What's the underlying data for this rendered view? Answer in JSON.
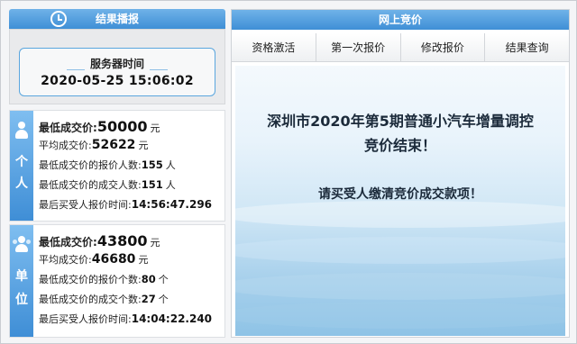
{
  "left": {
    "header_title": "结果播报",
    "server_label": "服务器时间",
    "server_time": "2020-05-25 15:06:02",
    "personal": {
      "tab_chars": [
        "个",
        "人"
      ],
      "rows": [
        {
          "label": "最低成交价:",
          "value": "50000",
          "unit": "元"
        },
        {
          "label": "平均成交价:",
          "value": "52622",
          "unit": "元"
        },
        {
          "label": "最低成交价的报价人数:",
          "value": "155",
          "unit": "人"
        },
        {
          "label": "最低成交价的成交人数:",
          "value": "151",
          "unit": "人"
        },
        {
          "label": "最后买受人报价时间:",
          "value": "14:56:47.296",
          "unit": ""
        }
      ]
    },
    "unit": {
      "tab_chars": [
        "单",
        "位"
      ],
      "rows": [
        {
          "label": "最低成交价:",
          "value": "43800",
          "unit": "元"
        },
        {
          "label": "平均成交价:",
          "value": "46680",
          "unit": "元"
        },
        {
          "label": "最低成交价的报价个数:",
          "value": "80",
          "unit": "个"
        },
        {
          "label": "最低成交价的成交个数:",
          "value": "27",
          "unit": "个"
        },
        {
          "label": "最后买受人报价时间:",
          "value": "14:04:22.240",
          "unit": ""
        }
      ]
    }
  },
  "right": {
    "header_title": "网上竞价",
    "tabs": [
      "资格激活",
      "第一次报价",
      "修改报价",
      "结果查询"
    ],
    "message_line1": "深圳市2020年第5期普通小汽车增量调控",
    "message_line2": "竞价结束！",
    "message_sub": "请买受人缴清竞价成交款项！"
  },
  "icons": {
    "clock": "clock-icon",
    "personal": "person-icon",
    "unit": "group-icon"
  },
  "colors": {
    "header_blue": "#3f8fd6",
    "accent_border": "#5aa6de"
  }
}
